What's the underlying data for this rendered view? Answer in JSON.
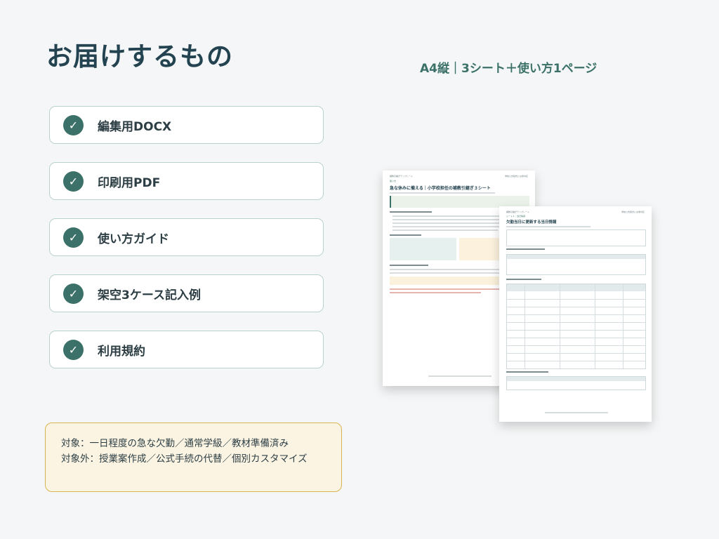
{
  "title": "お届けするもの",
  "subtitle": "A4縦｜3シート＋使い方1ページ",
  "items": [
    {
      "check": "✓",
      "label": "編集用DOCX"
    },
    {
      "check": "✓",
      "label": "印刷用PDF"
    },
    {
      "check": "✓",
      "label": "使い方ガイド"
    },
    {
      "check": "✓",
      "label": "架空3ケース記入例"
    },
    {
      "check": "✓",
      "label": "利用規約"
    }
  ],
  "note": {
    "line1": "対象：一日程度の急な欠勤／通常学級／教材準備済み",
    "line2": "対象外：授業案作成／公式手続の代替／個別カスタマイズ"
  },
  "colors": {
    "accent": "#3b7168",
    "title": "#234350",
    "note_bg": "#fbf4e3",
    "note_border": "#d8b453",
    "item_border": "#b9d3cc"
  },
  "icons": [
    "check-icon"
  ],
  "doc1": {
    "header_left": "補教引継ぎテンプレート",
    "header_right": "学校公式様式には非対応",
    "section": "使い方",
    "title": "急な休みに備える｜小学校担任の補教引継ぎ３シート"
  },
  "doc2": {
    "header_left": "補教引継ぎテンプレート",
    "header_right": "学校公式様式には非対応",
    "section": "シート１｜当日情報",
    "title": "欠勤当日に更新する当日情報"
  }
}
